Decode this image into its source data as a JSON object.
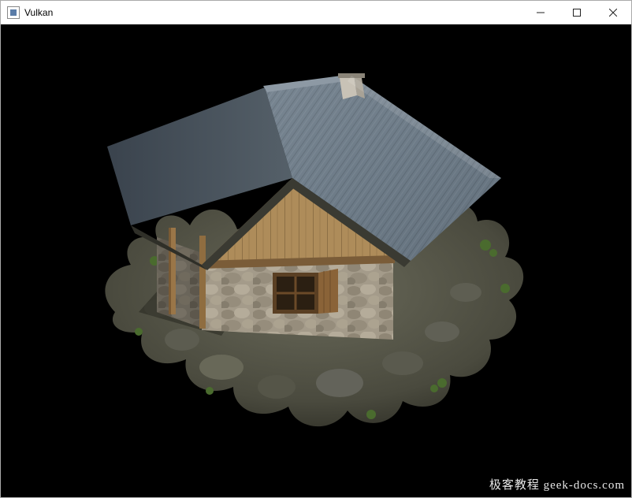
{
  "window": {
    "title": "Vulkan",
    "controls": {
      "minimize": "Minimize",
      "maximize": "Maximize",
      "close": "Close"
    }
  },
  "scene": {
    "description": "3D rendered model of a rustic stone and wood chalet with a corrugated slate roof, window with open shutter, front porch with wooden posts, surrounded by rocky terrain and sparse vegetation, viewed from an elevated angle on black background"
  },
  "watermark": {
    "text": "极客教程 geek-docs.com"
  }
}
